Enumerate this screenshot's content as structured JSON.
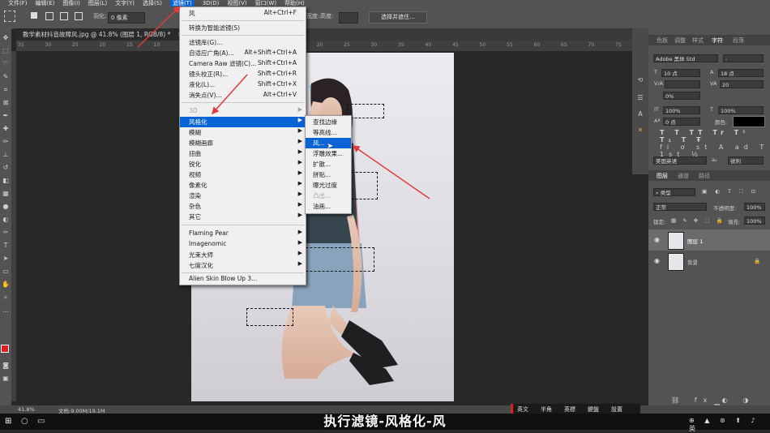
{
  "menubar": {
    "items": [
      "文件(F)",
      "编辑(E)",
      "图像(I)",
      "图层(L)",
      "文字(Y)",
      "选择(S)",
      "滤镜(T)",
      "3D(D)",
      "视图(V)",
      "窗口(W)",
      "帮助(H)"
    ],
    "active": "滤镜(T)"
  },
  "options_bar": {
    "feather_label": "羽化:",
    "feather_value": "0 像素",
    "width_label": "宽度:",
    "height_label": "高度:",
    "select_mask_button": "选择并遮住..."
  },
  "document": {
    "tab_title": "教学素材抖音故障风.jpg @ 41.8% (图层 1, RGB/8) *",
    "ruler_ticks": [
      "35",
      "30",
      "25",
      "20",
      "15",
      "10",
      "5",
      "0",
      "5",
      "10",
      "15",
      "20",
      "25",
      "30",
      "35",
      "40",
      "45",
      "50",
      "55",
      "60",
      "65",
      "70",
      "75"
    ]
  },
  "filter_menu": {
    "items": [
      {
        "label": "风",
        "shortcut": "Alt+Ctrl+F",
        "state": "normal"
      },
      {
        "sep": true
      },
      {
        "label": "转换为智能滤镜(S)",
        "shortcut": "",
        "state": "normal"
      },
      {
        "sep": true
      },
      {
        "label": "滤镜库(G)...",
        "shortcut": "",
        "state": "normal"
      },
      {
        "label": "自适应广角(A)...",
        "shortcut": "Alt+Shift+Ctrl+A",
        "state": "normal"
      },
      {
        "label": "Camera Raw 滤镜(C)...",
        "shortcut": "Shift+Ctrl+A",
        "state": "normal"
      },
      {
        "label": "镜头校正(R)...",
        "shortcut": "Shift+Ctrl+R",
        "state": "normal"
      },
      {
        "label": "液化(L)...",
        "shortcut": "Shift+Ctrl+X",
        "state": "normal"
      },
      {
        "label": "消失点(V)...",
        "shortcut": "Alt+Ctrl+V",
        "state": "normal"
      },
      {
        "sep": true
      },
      {
        "label": "3D",
        "shortcut": "",
        "state": "disabled",
        "submenu": true
      },
      {
        "label": "风格化",
        "shortcut": "",
        "state": "highlighted",
        "submenu": true
      },
      {
        "label": "模糊",
        "shortcut": "",
        "state": "normal",
        "submenu": true
      },
      {
        "label": "模糊画廊",
        "shortcut": "",
        "state": "normal",
        "submenu": true
      },
      {
        "label": "扭曲",
        "shortcut": "",
        "state": "normal",
        "submenu": true
      },
      {
        "label": "锐化",
        "shortcut": "",
        "state": "normal",
        "submenu": true
      },
      {
        "label": "视频",
        "shortcut": "",
        "state": "normal",
        "submenu": true
      },
      {
        "label": "像素化",
        "shortcut": "",
        "state": "normal",
        "submenu": true
      },
      {
        "label": "渲染",
        "shortcut": "",
        "state": "normal",
        "submenu": true
      },
      {
        "label": "杂色",
        "shortcut": "",
        "state": "normal",
        "submenu": true
      },
      {
        "label": "其它",
        "shortcut": "",
        "state": "normal",
        "submenu": true
      },
      {
        "sep": true
      },
      {
        "label": "Flaming Pear",
        "shortcut": "",
        "state": "normal",
        "submenu": true
      },
      {
        "label": "Imagenomic",
        "shortcut": "",
        "state": "normal",
        "submenu": true
      },
      {
        "label": "光束大师",
        "shortcut": "",
        "state": "normal",
        "submenu": true
      },
      {
        "label": "七度汉化",
        "shortcut": "",
        "state": "normal",
        "submenu": true
      },
      {
        "sep": true
      },
      {
        "label": "Alien Skin Blow Up 3...",
        "shortcut": "",
        "state": "normal"
      }
    ]
  },
  "stylize_submenu": {
    "items": [
      {
        "label": "查找边缘",
        "state": "normal"
      },
      {
        "label": "等高线...",
        "state": "normal"
      },
      {
        "label": "风...",
        "state": "highlighted"
      },
      {
        "label": "浮雕效果...",
        "state": "normal"
      },
      {
        "label": "扩散...",
        "state": "normal"
      },
      {
        "label": "拼贴...",
        "state": "normal"
      },
      {
        "label": "曝光过度",
        "state": "normal"
      },
      {
        "label": "凸出...",
        "state": "disabled"
      },
      {
        "label": "油画...",
        "state": "normal"
      }
    ]
  },
  "panels": {
    "top_tabs": [
      "色板",
      "调整",
      "样式",
      "字符",
      "段落"
    ],
    "top_active": "字符",
    "font_family": "Adobe 黑体 Std",
    "font_style": "-",
    "font_size": "10 点",
    "leading": "18 点",
    "kerning": "",
    "tracking": "20",
    "scale_pct": "0%",
    "vscale": "100%",
    "hscale": "100%",
    "baseline": "0 点",
    "color_label": "颜色:",
    "language": "美国英语",
    "antialias": "锐利",
    "layers_tabs": [
      "图层",
      "通道",
      "路径"
    ],
    "layers_active": "图层",
    "kind_filter": "类型",
    "blend_mode": "正常",
    "opacity_label": "不透明度:",
    "opacity_value": "100%",
    "lock_label": "锁定:",
    "fill_label": "填充:",
    "fill_value": "100%",
    "layers": [
      {
        "name": "图层 1",
        "selected": true
      },
      {
        "name": "背景",
        "selected": false
      }
    ]
  },
  "status": {
    "zoom": "41.8%",
    "doc_info": "文档:9.00M/19.1M"
  },
  "ime": {
    "items": [
      "英文",
      "半角",
      "英標",
      "鍵盤",
      "設置"
    ]
  },
  "caption": "执行滤镜-风格化-风",
  "colors": {
    "accent_highlight": "#0a64d6",
    "annotation_arrow": "#e23b3b",
    "foreground_swatch": "#e02020"
  }
}
